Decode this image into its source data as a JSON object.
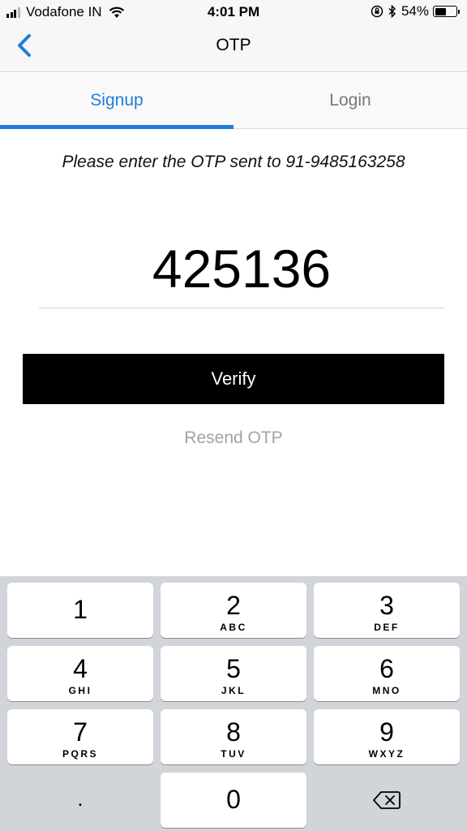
{
  "status_bar": {
    "carrier": "Vodafone IN",
    "time": "4:01 PM",
    "battery_percent": "54%",
    "battery_level": 0.54,
    "signal_bars_filled": 3,
    "signal_bars_total": 4
  },
  "nav": {
    "title": "OTP",
    "back_icon": "chevron-left-icon"
  },
  "tabs": [
    {
      "label": "Signup",
      "active": true
    },
    {
      "label": "Login",
      "active": false
    }
  ],
  "otp": {
    "instruction": "Please enter the OTP sent to 91-9485163258",
    "value": "425136"
  },
  "actions": {
    "verify_label": "Verify",
    "resend_label": "Resend OTP"
  },
  "keyboard": {
    "keys": [
      {
        "num": "1",
        "letters": ""
      },
      {
        "num": "2",
        "letters": "ABC"
      },
      {
        "num": "3",
        "letters": "DEF"
      },
      {
        "num": "4",
        "letters": "GHI"
      },
      {
        "num": "5",
        "letters": "JKL"
      },
      {
        "num": "6",
        "letters": "MNO"
      },
      {
        "num": "7",
        "letters": "PQRS"
      },
      {
        "num": "8",
        "letters": "TUV"
      },
      {
        "num": "9",
        "letters": "WXYZ"
      }
    ],
    "dot_label": ".",
    "zero_label": "0",
    "delete_icon": "backspace-icon"
  },
  "colors": {
    "accent": "#1f7ddc",
    "button_bg": "#000000",
    "resend_text": "#a3a3a3",
    "keyboard_bg": "#d1d4d9"
  }
}
